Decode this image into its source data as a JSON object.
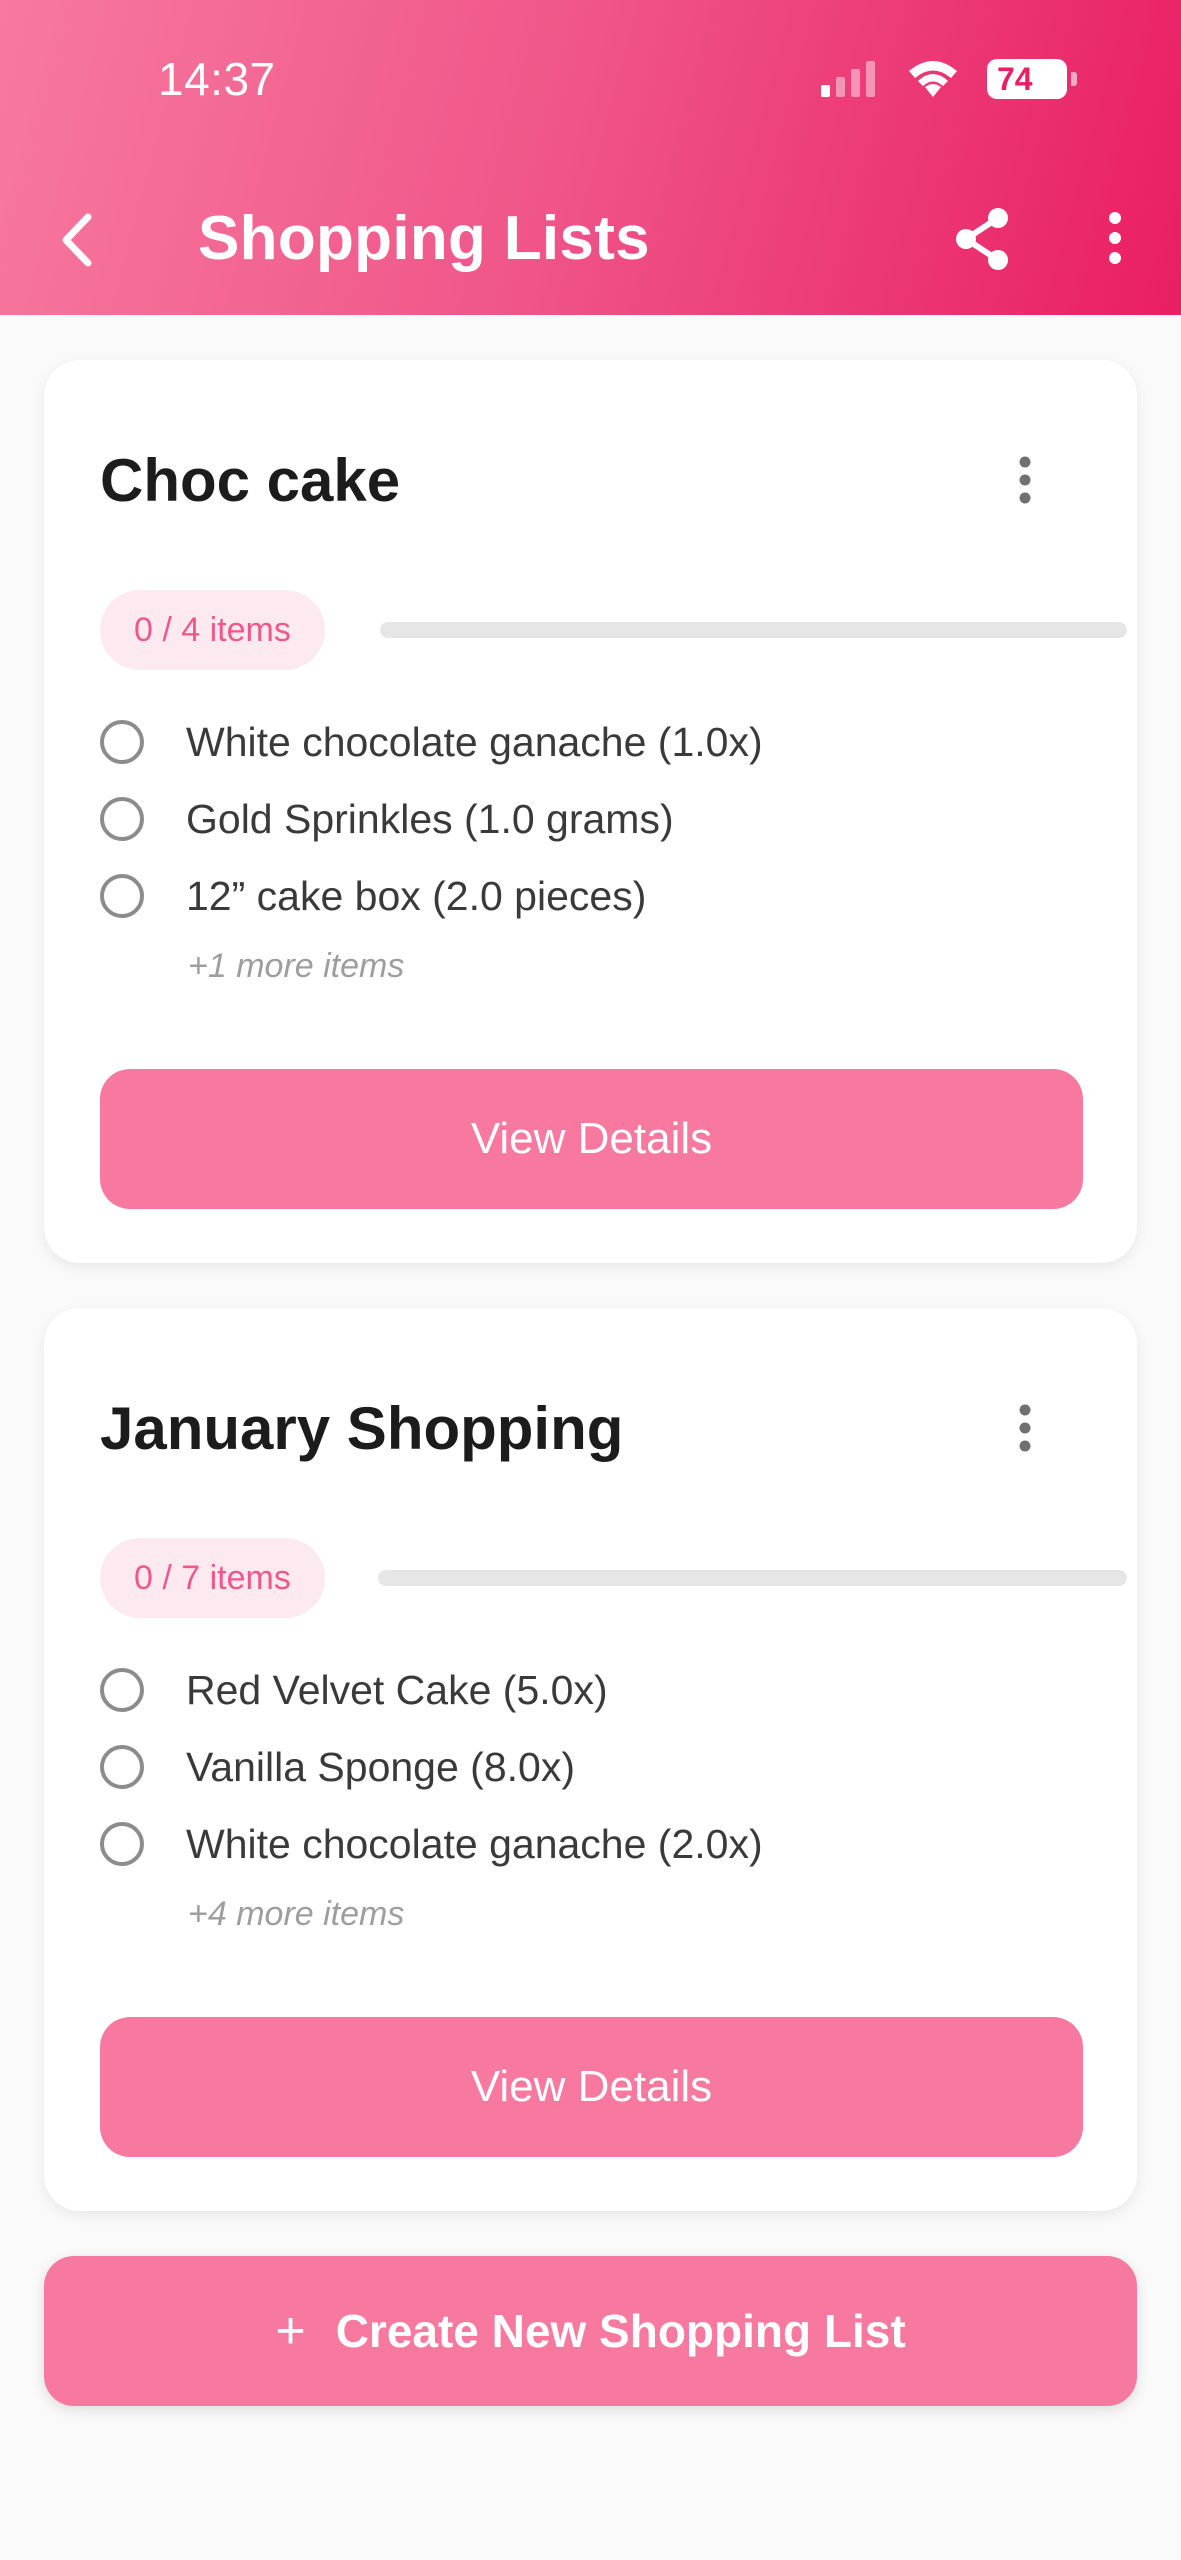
{
  "status_bar": {
    "time": "14:37",
    "battery": "74"
  },
  "header": {
    "title": "Shopping Lists"
  },
  "icons": {
    "back": "chevron-left-icon",
    "share": "share-icon",
    "more": "more-vertical-icon",
    "radio": "radio-unchecked-icon",
    "plus": "plus-icon"
  },
  "colors": {
    "accent": "#e91e63",
    "button": "#f7799f",
    "badge_bg": "#fdeaf0",
    "badge_text": "#f0578a"
  },
  "lists": [
    {
      "title": "Choc cake",
      "badge": "0 / 4 items",
      "progress": 0,
      "items": [
        {
          "label": "White chocolate ganache (1.0x)",
          "checked": false
        },
        {
          "label": "Gold Sprinkles (1.0 grams)",
          "checked": false
        },
        {
          "label": "12” cake box (2.0 pieces)",
          "checked": false
        }
      ],
      "more_items": "+1 more items",
      "button_label": "View Details"
    },
    {
      "title": "January Shopping",
      "badge": "0 / 7 items",
      "progress": 0,
      "items": [
        {
          "label": "Red Velvet Cake (5.0x)",
          "checked": false
        },
        {
          "label": "Vanilla Sponge (8.0x)",
          "checked": false
        },
        {
          "label": "White chocolate ganache (2.0x)",
          "checked": false
        }
      ],
      "more_items": "+4 more items",
      "button_label": "View Details"
    }
  ],
  "create_button": {
    "icon": "+",
    "label": "Create New Shopping List"
  }
}
